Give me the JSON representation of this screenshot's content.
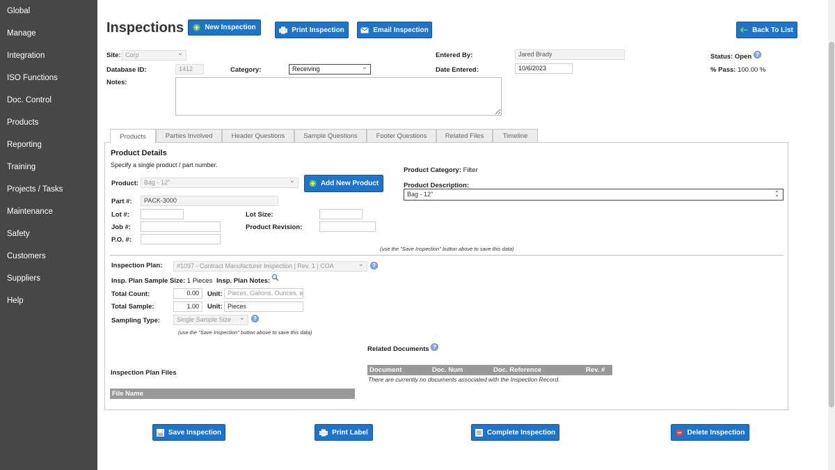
{
  "sidebar": {
    "items": [
      "Global",
      "Manage",
      "Integration",
      "ISO Functions",
      "Doc. Control",
      "Products",
      "Reporting",
      "Training",
      "Projects / Tasks",
      "Maintenance",
      "Safety",
      "Customers",
      "Suppliers",
      "Help"
    ]
  },
  "header": {
    "title": "Inspections",
    "new_inspection": "New Inspection",
    "print_inspection": "Print Inspection",
    "email_inspection": "Email Inspection",
    "back_to_list": "Back To List"
  },
  "form": {
    "site_label": "Site:",
    "site_value": "Corp",
    "database_id_label": "Database ID:",
    "database_id_value": "1412",
    "category_label": "Category:",
    "category_value": "Receiving",
    "notes_label": "Notes:",
    "entered_by_label": "Entered By:",
    "entered_by_value": "Jared Brady",
    "date_entered_label": "Date Entered:",
    "date_entered_value": "10/6/2023",
    "status_label": "Status:",
    "status_value": "Open",
    "pass_label": "% Pass:",
    "pass_value": "100.00 %"
  },
  "tabs": [
    "Products",
    "Parties Involved",
    "Header Questions",
    "Sample Questions",
    "Footer Questions",
    "Related Files",
    "Timeline"
  ],
  "product": {
    "section_title": "Product Details",
    "instruction": "Specify a single product / part number.",
    "product_label": "Product:",
    "product_value": "Bag - 12\"",
    "add_new_product": "Add New Product",
    "part_label": "Part #:",
    "part_value": "PACK-3000",
    "lot_label": "Lot #:",
    "lot_size_label": "Lot Size:",
    "job_label": "Job #:",
    "revision_label": "Product Revision:",
    "po_label": "P.O. #:",
    "category_label": "Product Category:",
    "category_value": "Filter",
    "description_label": "Product Description:",
    "description_value": "Bag - 12\"",
    "save_note": "(use the \"Save Inspection\" button above to save this data)"
  },
  "plan": {
    "plan_label": "Inspection Plan:",
    "plan_value": "#1097 - Contract Manufacturer Inspection | Rev. 1 | COA",
    "sample_size_label": "Insp. Plan Sample Size:",
    "sample_size_value": "1 Pieces",
    "notes_label": "Insp. Plan Notes:",
    "total_count_label": "Total Count:",
    "total_count_value": "0.00",
    "unit_label": "Unit:",
    "count_unit_placeholder": "Pieces, Gallons, Ounces, etc.",
    "total_sample_label": "Total Sample:",
    "total_sample_value": "1.00",
    "sample_unit_value": "Pieces",
    "sampling_type_label": "Sampling Type:",
    "sampling_type_value": "Single Sample Size",
    "save_note": "(use the \"Save Inspection\" button above to save this data)"
  },
  "files": {
    "title": "Inspection Plan Files",
    "column": "File Name"
  },
  "related_docs": {
    "title": "Related Documents",
    "columns": [
      "Document",
      "Doc. Num",
      "Doc. Reference",
      "Rev. #"
    ],
    "empty": "There are currently no documents associated with the Inspection Record."
  },
  "footer": {
    "save": "Save Inspection",
    "print_label": "Print Label",
    "complete": "Complete Inspection",
    "delete": "Delete Inspection"
  },
  "colors": {
    "sidebar_bg": "#474747",
    "button_blue": "#1f73c8",
    "table_header": "#999999"
  }
}
